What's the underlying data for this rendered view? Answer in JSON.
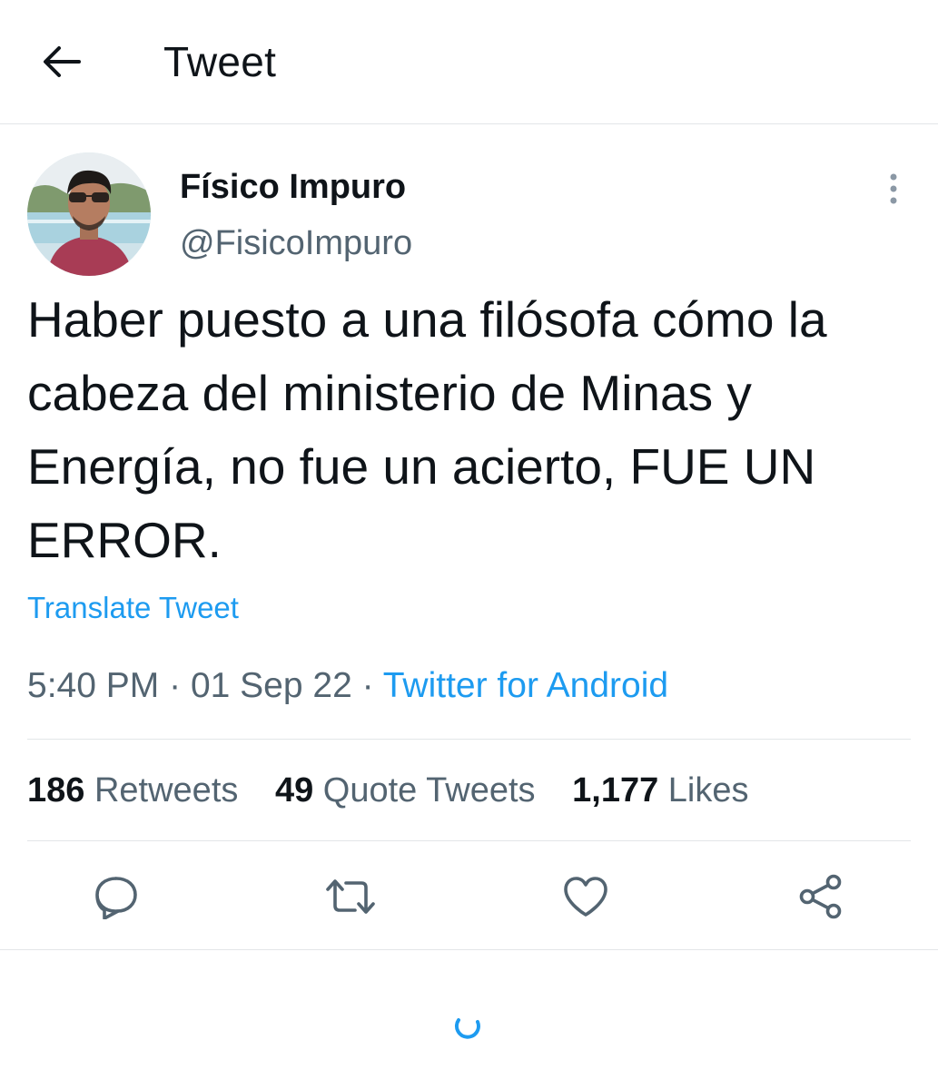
{
  "header": {
    "title": "Tweet",
    "back_icon": "arrow-left-icon"
  },
  "author": {
    "display_name": "Físico Impuro",
    "handle": "@FisicoImpuro",
    "more_icon": "more-vertical-icon"
  },
  "tweet": {
    "text": "Haber puesto a una filósofa cómo la cabeza del ministerio de Minas y Energía, no fue un acierto, FUE UN ERROR.",
    "translate_label": "Translate Tweet"
  },
  "meta": {
    "time": "5:40 PM",
    "separator": "·",
    "date": "01 Sep 22",
    "source": "Twitter for Android"
  },
  "stats": {
    "retweets_count": "186",
    "retweets_label": "Retweets",
    "quotes_count": "49",
    "quotes_label": "Quote Tweets",
    "likes_count": "1,177",
    "likes_label": "Likes"
  },
  "actions": [
    "reply-icon",
    "retweet-icon",
    "like-icon",
    "share-icon"
  ],
  "colors": {
    "accent": "#1d9bf0",
    "text_primary": "#0f1419",
    "text_secondary": "#536471",
    "divider": "#e3e6e8",
    "icon": "#536471"
  }
}
